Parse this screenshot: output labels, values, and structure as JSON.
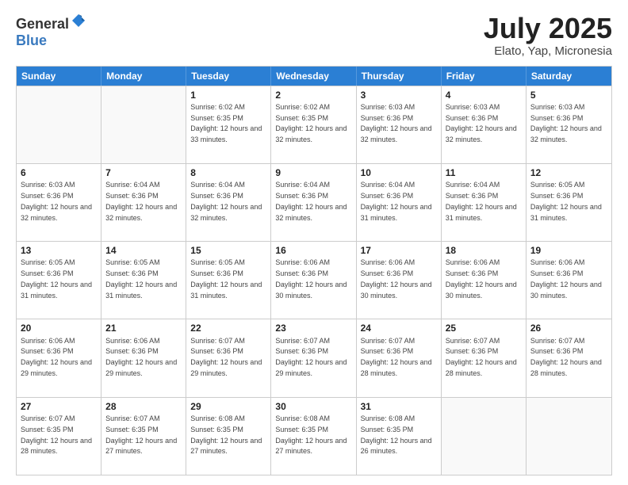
{
  "header": {
    "logo_general": "General",
    "logo_blue": "Blue",
    "month": "July 2025",
    "location": "Elato, Yap, Micronesia"
  },
  "days_of_week": [
    "Sunday",
    "Monday",
    "Tuesday",
    "Wednesday",
    "Thursday",
    "Friday",
    "Saturday"
  ],
  "weeks": [
    [
      {
        "day": "",
        "sunrise": "",
        "sunset": "",
        "daylight": ""
      },
      {
        "day": "",
        "sunrise": "",
        "sunset": "",
        "daylight": ""
      },
      {
        "day": "1",
        "sunrise": "Sunrise: 6:02 AM",
        "sunset": "Sunset: 6:35 PM",
        "daylight": "Daylight: 12 hours and 33 minutes."
      },
      {
        "day": "2",
        "sunrise": "Sunrise: 6:02 AM",
        "sunset": "Sunset: 6:35 PM",
        "daylight": "Daylight: 12 hours and 32 minutes."
      },
      {
        "day": "3",
        "sunrise": "Sunrise: 6:03 AM",
        "sunset": "Sunset: 6:36 PM",
        "daylight": "Daylight: 12 hours and 32 minutes."
      },
      {
        "day": "4",
        "sunrise": "Sunrise: 6:03 AM",
        "sunset": "Sunset: 6:36 PM",
        "daylight": "Daylight: 12 hours and 32 minutes."
      },
      {
        "day": "5",
        "sunrise": "Sunrise: 6:03 AM",
        "sunset": "Sunset: 6:36 PM",
        "daylight": "Daylight: 12 hours and 32 minutes."
      }
    ],
    [
      {
        "day": "6",
        "sunrise": "Sunrise: 6:03 AM",
        "sunset": "Sunset: 6:36 PM",
        "daylight": "Daylight: 12 hours and 32 minutes."
      },
      {
        "day": "7",
        "sunrise": "Sunrise: 6:04 AM",
        "sunset": "Sunset: 6:36 PM",
        "daylight": "Daylight: 12 hours and 32 minutes."
      },
      {
        "day": "8",
        "sunrise": "Sunrise: 6:04 AM",
        "sunset": "Sunset: 6:36 PM",
        "daylight": "Daylight: 12 hours and 32 minutes."
      },
      {
        "day": "9",
        "sunrise": "Sunrise: 6:04 AM",
        "sunset": "Sunset: 6:36 PM",
        "daylight": "Daylight: 12 hours and 32 minutes."
      },
      {
        "day": "10",
        "sunrise": "Sunrise: 6:04 AM",
        "sunset": "Sunset: 6:36 PM",
        "daylight": "Daylight: 12 hours and 31 minutes."
      },
      {
        "day": "11",
        "sunrise": "Sunrise: 6:04 AM",
        "sunset": "Sunset: 6:36 PM",
        "daylight": "Daylight: 12 hours and 31 minutes."
      },
      {
        "day": "12",
        "sunrise": "Sunrise: 6:05 AM",
        "sunset": "Sunset: 6:36 PM",
        "daylight": "Daylight: 12 hours and 31 minutes."
      }
    ],
    [
      {
        "day": "13",
        "sunrise": "Sunrise: 6:05 AM",
        "sunset": "Sunset: 6:36 PM",
        "daylight": "Daylight: 12 hours and 31 minutes."
      },
      {
        "day": "14",
        "sunrise": "Sunrise: 6:05 AM",
        "sunset": "Sunset: 6:36 PM",
        "daylight": "Daylight: 12 hours and 31 minutes."
      },
      {
        "day": "15",
        "sunrise": "Sunrise: 6:05 AM",
        "sunset": "Sunset: 6:36 PM",
        "daylight": "Daylight: 12 hours and 31 minutes."
      },
      {
        "day": "16",
        "sunrise": "Sunrise: 6:06 AM",
        "sunset": "Sunset: 6:36 PM",
        "daylight": "Daylight: 12 hours and 30 minutes."
      },
      {
        "day": "17",
        "sunrise": "Sunrise: 6:06 AM",
        "sunset": "Sunset: 6:36 PM",
        "daylight": "Daylight: 12 hours and 30 minutes."
      },
      {
        "day": "18",
        "sunrise": "Sunrise: 6:06 AM",
        "sunset": "Sunset: 6:36 PM",
        "daylight": "Daylight: 12 hours and 30 minutes."
      },
      {
        "day": "19",
        "sunrise": "Sunrise: 6:06 AM",
        "sunset": "Sunset: 6:36 PM",
        "daylight": "Daylight: 12 hours and 30 minutes."
      }
    ],
    [
      {
        "day": "20",
        "sunrise": "Sunrise: 6:06 AM",
        "sunset": "Sunset: 6:36 PM",
        "daylight": "Daylight: 12 hours and 29 minutes."
      },
      {
        "day": "21",
        "sunrise": "Sunrise: 6:06 AM",
        "sunset": "Sunset: 6:36 PM",
        "daylight": "Daylight: 12 hours and 29 minutes."
      },
      {
        "day": "22",
        "sunrise": "Sunrise: 6:07 AM",
        "sunset": "Sunset: 6:36 PM",
        "daylight": "Daylight: 12 hours and 29 minutes."
      },
      {
        "day": "23",
        "sunrise": "Sunrise: 6:07 AM",
        "sunset": "Sunset: 6:36 PM",
        "daylight": "Daylight: 12 hours and 29 minutes."
      },
      {
        "day": "24",
        "sunrise": "Sunrise: 6:07 AM",
        "sunset": "Sunset: 6:36 PM",
        "daylight": "Daylight: 12 hours and 28 minutes."
      },
      {
        "day": "25",
        "sunrise": "Sunrise: 6:07 AM",
        "sunset": "Sunset: 6:36 PM",
        "daylight": "Daylight: 12 hours and 28 minutes."
      },
      {
        "day": "26",
        "sunrise": "Sunrise: 6:07 AM",
        "sunset": "Sunset: 6:36 PM",
        "daylight": "Daylight: 12 hours and 28 minutes."
      }
    ],
    [
      {
        "day": "27",
        "sunrise": "Sunrise: 6:07 AM",
        "sunset": "Sunset: 6:35 PM",
        "daylight": "Daylight: 12 hours and 28 minutes."
      },
      {
        "day": "28",
        "sunrise": "Sunrise: 6:07 AM",
        "sunset": "Sunset: 6:35 PM",
        "daylight": "Daylight: 12 hours and 27 minutes."
      },
      {
        "day": "29",
        "sunrise": "Sunrise: 6:08 AM",
        "sunset": "Sunset: 6:35 PM",
        "daylight": "Daylight: 12 hours and 27 minutes."
      },
      {
        "day": "30",
        "sunrise": "Sunrise: 6:08 AM",
        "sunset": "Sunset: 6:35 PM",
        "daylight": "Daylight: 12 hours and 27 minutes."
      },
      {
        "day": "31",
        "sunrise": "Sunrise: 6:08 AM",
        "sunset": "Sunset: 6:35 PM",
        "daylight": "Daylight: 12 hours and 26 minutes."
      },
      {
        "day": "",
        "sunrise": "",
        "sunset": "",
        "daylight": ""
      },
      {
        "day": "",
        "sunrise": "",
        "sunset": "",
        "daylight": ""
      }
    ]
  ]
}
